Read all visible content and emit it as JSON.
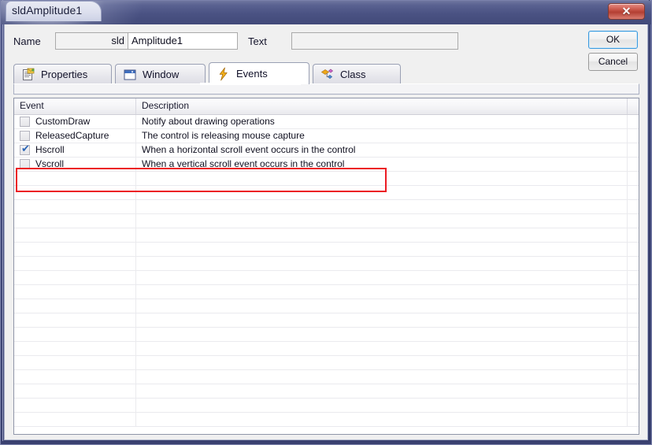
{
  "window": {
    "title": "sldAmplitude1",
    "close_label": "✕"
  },
  "header": {
    "name_label": "Name",
    "name_prefix": "sld",
    "name_value": "Amplitude1",
    "text_label": "Text",
    "text_value": "",
    "text_placeholder": "",
    "ok_label": "OK",
    "cancel_label": "Cancel"
  },
  "tabs": [
    {
      "label": "Properties",
      "icon": "clipboard-icon",
      "active": false
    },
    {
      "label": "Window",
      "icon": "window-icon",
      "active": false
    },
    {
      "label": "Events",
      "icon": "lightning-bolt-icon",
      "active": true
    },
    {
      "label": "Class",
      "icon": "class-diamond-icon",
      "active": false
    }
  ],
  "list": {
    "columns": [
      "Event",
      "Description",
      ""
    ],
    "rows": [
      {
        "checked": false,
        "event": "CustomDraw",
        "description": "Notify about drawing operations"
      },
      {
        "checked": false,
        "event": "ReleasedCapture",
        "description": "The control is releasing mouse capture"
      },
      {
        "checked": true,
        "event": "Hscroll",
        "description": "When a horizontal scroll event occurs in the control"
      },
      {
        "checked": false,
        "event": "Vscroll",
        "description": "When a vertical scroll event occurs in the control"
      }
    ],
    "empty_row_count": 18,
    "checkmark_glyph": "✔"
  },
  "annotation": {
    "color": "#ec1c24",
    "target_row": "Hscroll"
  }
}
